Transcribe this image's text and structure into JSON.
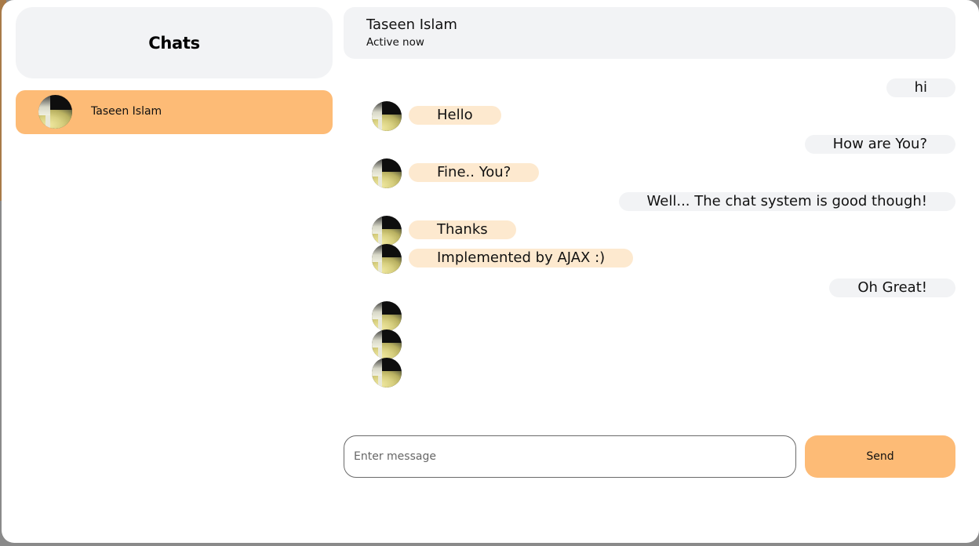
{
  "sidebar": {
    "title": "Chats",
    "contacts": [
      {
        "name": "Taseen Islam"
      }
    ]
  },
  "chat": {
    "name": "Taseen Islam",
    "status": "Active now"
  },
  "messages": [
    {
      "dir": "sent",
      "text": "hi"
    },
    {
      "dir": "received",
      "text": "Hello"
    },
    {
      "dir": "sent",
      "text": "How are You?"
    },
    {
      "dir": "received",
      "text": "Fine.. You?"
    },
    {
      "dir": "sent",
      "text": "Well... The chat system is good though!"
    },
    {
      "dir": "received",
      "text": "Thanks"
    },
    {
      "dir": "received",
      "text": "Implemented by AJAX :)"
    },
    {
      "dir": "sent",
      "text": "Oh Great!"
    },
    {
      "dir": "received",
      "text": ""
    },
    {
      "dir": "received",
      "text": ""
    },
    {
      "dir": "received",
      "text": ""
    }
  ],
  "composer": {
    "placeholder": "Enter message",
    "value": "",
    "send_label": "Send"
  },
  "colors": {
    "accent": "#fdbb76",
    "received_bubble": "#fde9cf",
    "sent_bubble": "#f2f3f5"
  }
}
